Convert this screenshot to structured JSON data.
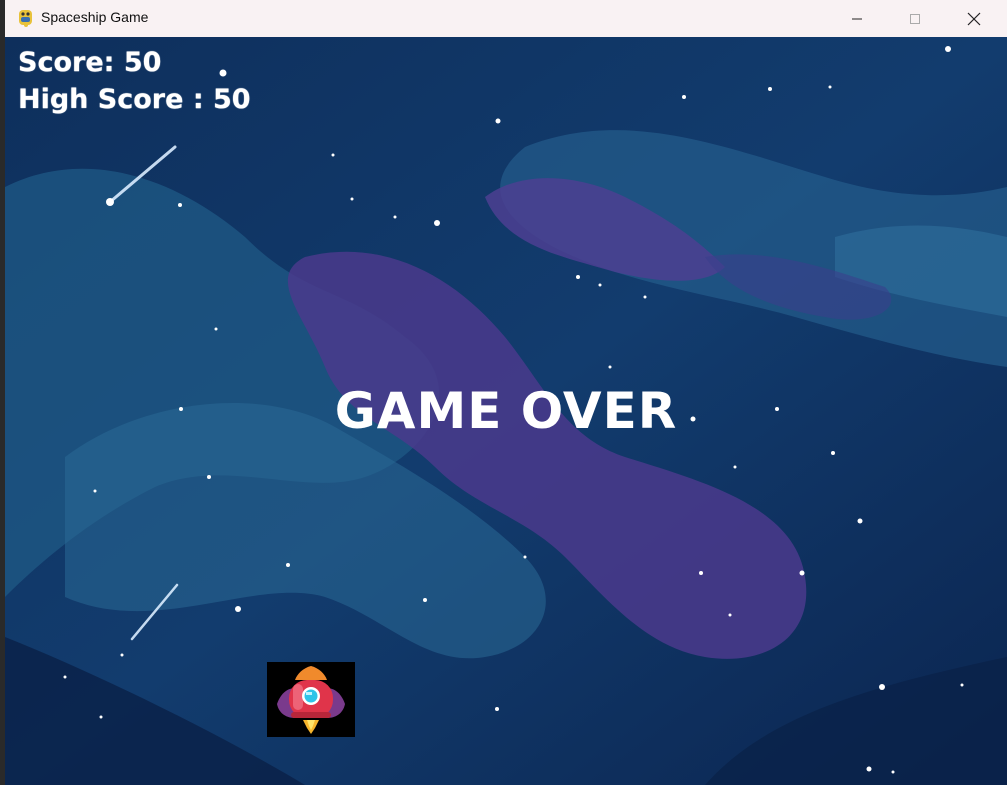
{
  "window": {
    "title": "Spaceship Game",
    "app_icon": "python-icon",
    "controls": [
      "minimize-icon",
      "maximize-icon",
      "close-icon"
    ]
  },
  "hud": {
    "score_text": "Score: 50",
    "high_score_text": "High Score : 50"
  },
  "game": {
    "status_text": "GAME OVER",
    "player_icon": "rocket-ship-icon"
  },
  "colors": {
    "space_dark": "#0f2a55",
    "nebula_blue": "#1f5a86",
    "nebula_purple": "#4a3a8c",
    "text": "#ffffff",
    "titlebar": "#f9f2f3"
  }
}
